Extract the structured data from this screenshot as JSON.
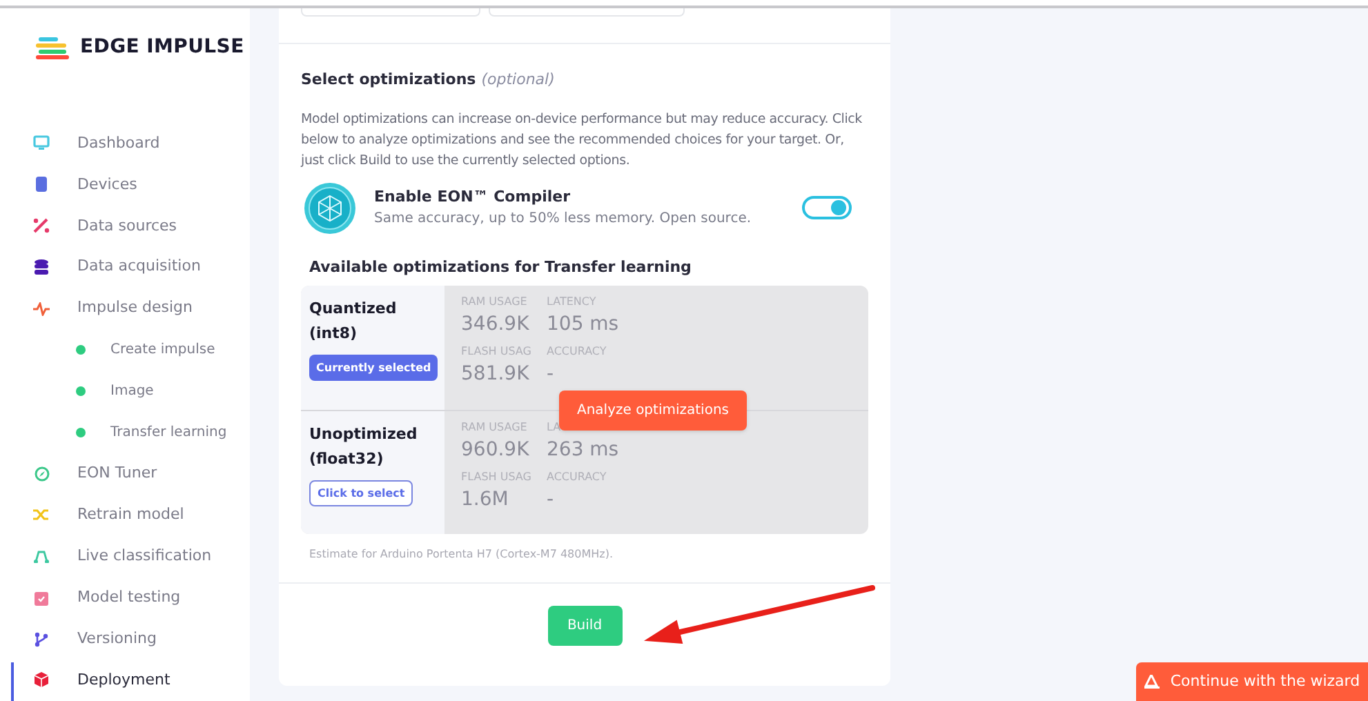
{
  "logo": {
    "text": "EDGE IMPULSE"
  },
  "sidebar": {
    "items": [
      {
        "label": "Dashboard",
        "kind": "main",
        "selected": false
      },
      {
        "label": "Devices",
        "kind": "main",
        "selected": false
      },
      {
        "label": "Data sources",
        "kind": "main",
        "selected": false
      },
      {
        "label": "Data acquisition",
        "kind": "main",
        "selected": false
      },
      {
        "label": "Impulse design",
        "kind": "main",
        "selected": false
      },
      {
        "label": "Create impulse",
        "kind": "sub",
        "selected": false
      },
      {
        "label": "Image",
        "kind": "sub",
        "selected": false
      },
      {
        "label": "Transfer learning",
        "kind": "sub",
        "selected": false
      },
      {
        "label": "EON Tuner",
        "kind": "main",
        "selected": false
      },
      {
        "label": "Retrain model",
        "kind": "main",
        "selected": false
      },
      {
        "label": "Live classification",
        "kind": "main",
        "selected": false
      },
      {
        "label": "Model testing",
        "kind": "main",
        "selected": false
      },
      {
        "label": "Versioning",
        "kind": "main",
        "selected": false
      },
      {
        "label": "Deployment",
        "kind": "main",
        "selected": true
      }
    ]
  },
  "section": {
    "title": "Select optimizations",
    "title_note": "(optional)",
    "description": "Model optimizations can increase on-device performance but may reduce accuracy. Click below to analyze optimizations and see the recommended choices for your target. Or, just click Build to use the currently selected options.",
    "eon": {
      "title": "Enable EON™ Compiler",
      "subtitle": "Same accuracy, up to 50% less memory. Open source.",
      "on": true
    },
    "optimizations_title": "Available optimizations for Transfer learning",
    "optimizations": [
      {
        "name": "Quantized (int8)",
        "button": "Currently selected",
        "selected": true,
        "metrics": [
          {
            "label": "RAM USAGE",
            "value": "346.9K"
          },
          {
            "label": "LATENCY",
            "value": "105 ms"
          },
          {
            "label": "FLASH USAG",
            "value": "581.9K"
          },
          {
            "label": "ACCURACY",
            "value": "-"
          }
        ]
      },
      {
        "name": "Unoptimized (float32)",
        "button": "Click to select",
        "selected": false,
        "metrics": [
          {
            "label": "RAM USAGE",
            "value": "960.9K"
          },
          {
            "label": "LA",
            "value": "263 ms"
          },
          {
            "label": "FLASH USAG",
            "value": "1.6M"
          },
          {
            "label": "ACCURACY",
            "value": "-"
          }
        ]
      }
    ],
    "analyze_button": "Analyze optimizations",
    "estimate": "Estimate for Arduino Portenta H7 (Cortex-M7 480MHz).",
    "build_button": "Build"
  },
  "wizard_button": "Continue with the wizard"
}
